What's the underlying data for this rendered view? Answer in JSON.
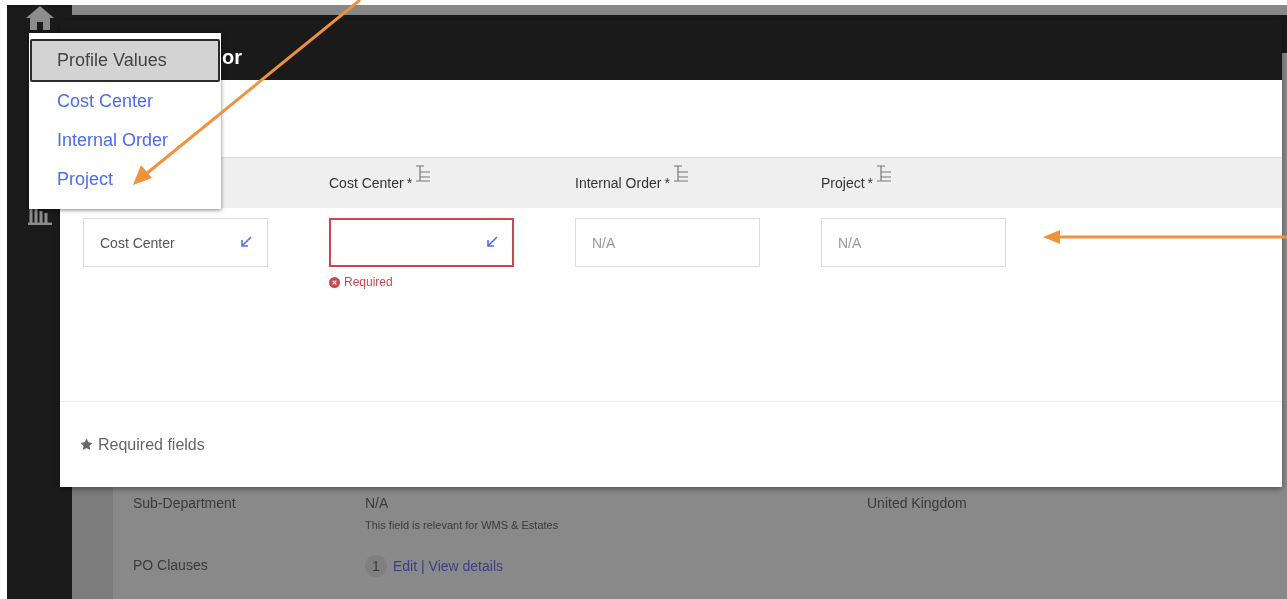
{
  "page": {
    "details": [
      {
        "kind": "note",
        "label": "Sub-Department",
        "value": "N/A",
        "note": "This field is relevant for WMS & Estates",
        "extra": "United Kingdom"
      },
      {
        "kind": "links",
        "label": "PO Clauses",
        "count": "1",
        "links": [
          "Edit",
          "View details"
        ],
        "separator": "|"
      }
    ]
  },
  "modal": {
    "title": "or",
    "fields": [
      {
        "kind": "lookup",
        "value": "Cost Center",
        "invalid": false
      },
      {
        "header": "Cost Center",
        "required_mark": "*",
        "kind": "lookup",
        "invalid": true,
        "error": "Required"
      },
      {
        "header": "Internal Order",
        "required_mark": "*",
        "kind": "text",
        "placeholder": "N/A",
        "invalid": false
      },
      {
        "header": "Project",
        "required_mark": "*",
        "kind": "text",
        "placeholder": "N/A",
        "invalid": false
      }
    ],
    "footer_note": "Required fields"
  },
  "dropdown": {
    "items": [
      {
        "label": "Profile Values",
        "selected": true
      },
      {
        "label": "Cost Center",
        "selected": false
      },
      {
        "label": "Internal Order",
        "selected": false
      },
      {
        "label": "Project",
        "selected": false
      }
    ]
  }
}
